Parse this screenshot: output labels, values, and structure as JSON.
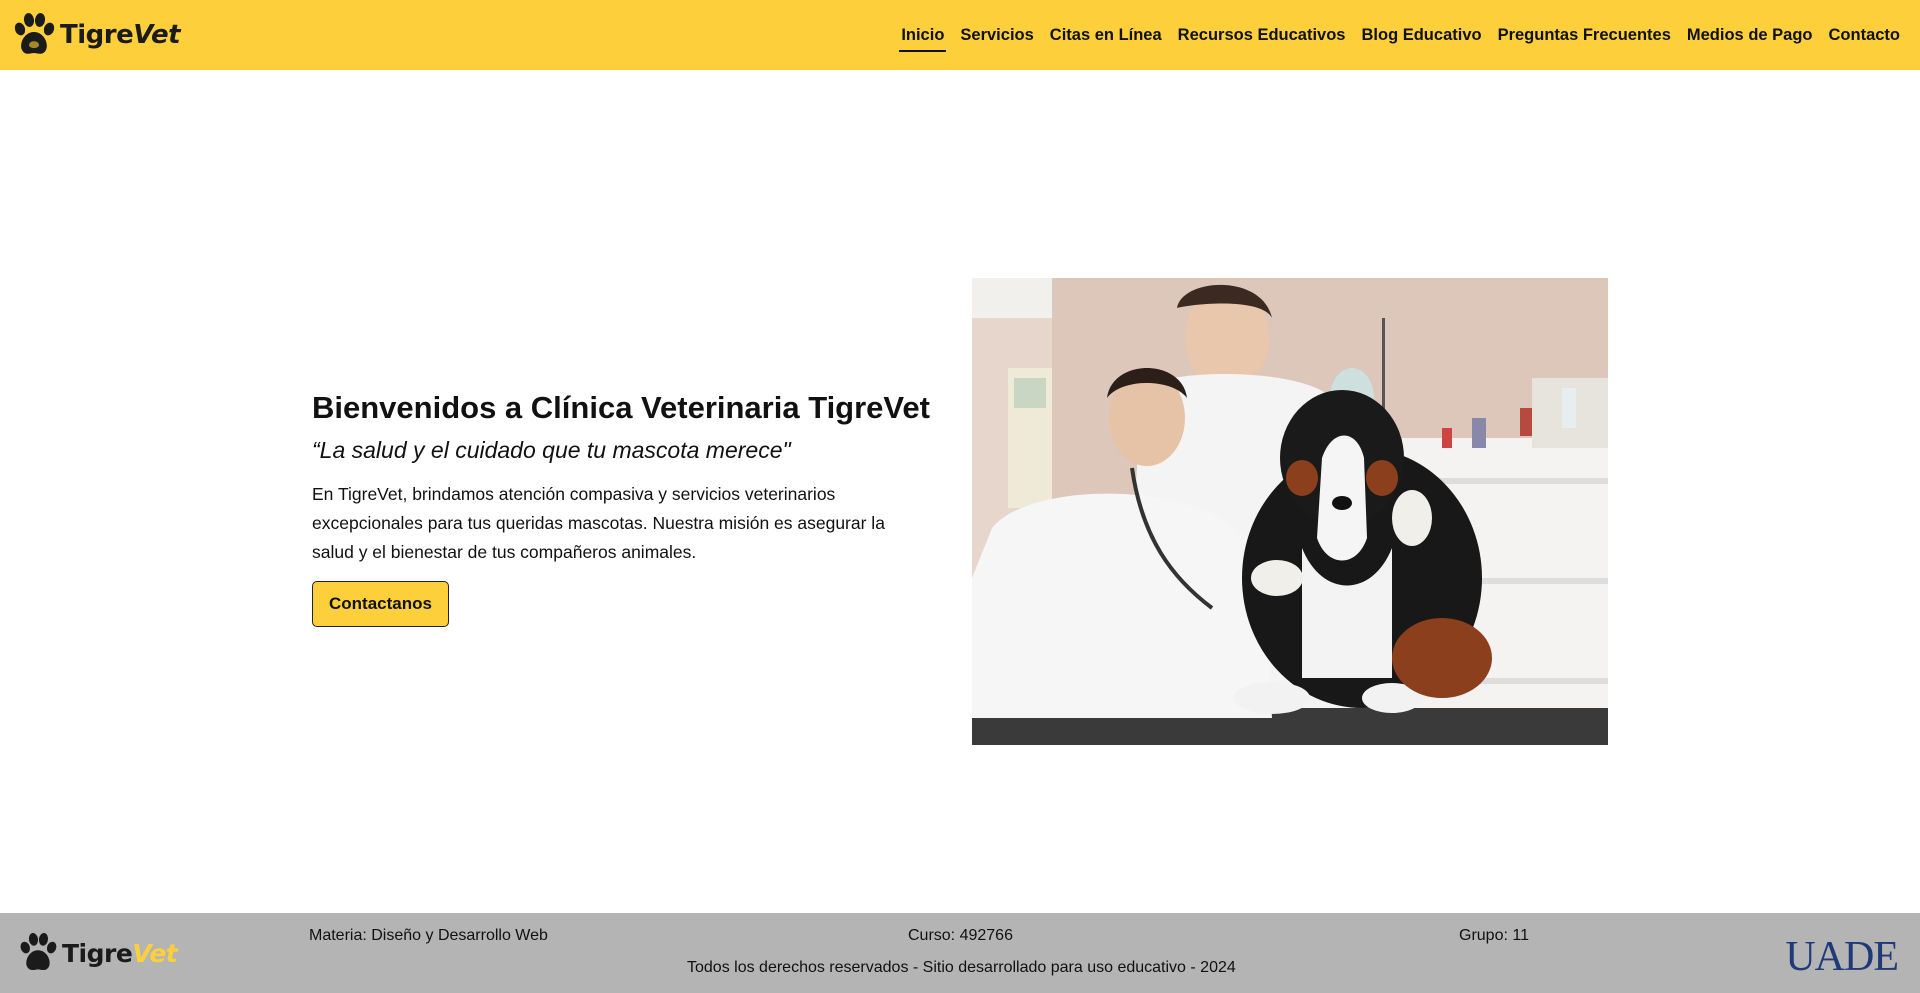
{
  "brand": {
    "name_part1": "Tigre",
    "name_part2": "Vet"
  },
  "nav": {
    "items": [
      {
        "label": "Inicio",
        "active": true
      },
      {
        "label": "Servicios"
      },
      {
        "label": "Citas en Línea"
      },
      {
        "label": "Recursos Educativos"
      },
      {
        "label": "Blog Educativo"
      },
      {
        "label": "Preguntas Frecuentes"
      },
      {
        "label": "Medios de Pago"
      },
      {
        "label": "Contacto"
      }
    ]
  },
  "hero": {
    "title": "Bienvenidos a Clínica Veterinaria TigreVet",
    "quote": "“La salud y el cuidado que tu mascota merece\"",
    "description": "En TigreVet, brindamos atención compasiva y servicios veterinarios excepcionales para tus queridas mascotas. Nuestra misión es asegurar la salud y el bienestar de tus compañeros animales.",
    "cta_label": "Contactanos"
  },
  "footer": {
    "materia": "Materia: Diseño y Desarrollo Web",
    "curso": "Curso: 492766",
    "grupo": "Grupo: 11",
    "rights": "Todos los derechos reservados - Sitio desarrollado para uso educativo - 2024",
    "institution_logo": "UADE"
  },
  "colors": {
    "accent": "#fdd03b",
    "footer_bg": "#b4b4b4",
    "institution": "#1f3a77"
  },
  "icons": {
    "logo": "paw-print-icon"
  }
}
